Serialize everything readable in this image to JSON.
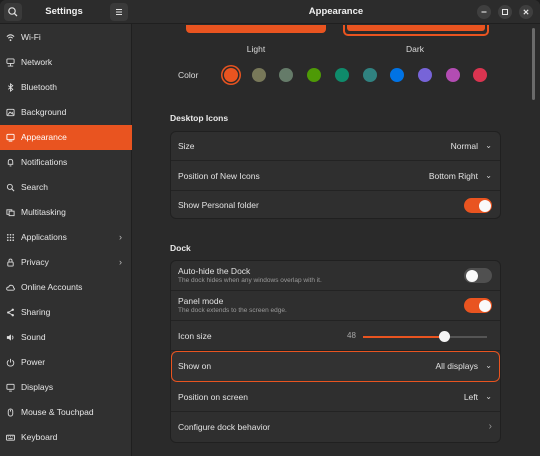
{
  "sidebar": {
    "title": "Settings",
    "items": [
      {
        "label": "Wi-Fi",
        "icon": "wifi-icon"
      },
      {
        "label": "Network",
        "icon": "network-icon"
      },
      {
        "label": "Bluetooth",
        "icon": "bluetooth-icon"
      },
      {
        "label": "Background",
        "icon": "background-icon"
      },
      {
        "label": "Appearance",
        "icon": "appearance-icon",
        "active": true
      },
      {
        "label": "Notifications",
        "icon": "bell-icon"
      },
      {
        "label": "Search",
        "icon": "search-icon"
      },
      {
        "label": "Multitasking",
        "icon": "multitasking-icon"
      },
      {
        "label": "Applications",
        "icon": "applications-icon",
        "chevron": true
      },
      {
        "label": "Privacy",
        "icon": "privacy-icon",
        "chevron": true
      },
      {
        "label": "Online Accounts",
        "icon": "online-accounts-icon"
      },
      {
        "label": "Sharing",
        "icon": "sharing-icon"
      },
      {
        "label": "Sound",
        "icon": "sound-icon"
      },
      {
        "label": "Power",
        "icon": "power-icon"
      },
      {
        "label": "Displays",
        "icon": "displays-icon"
      },
      {
        "label": "Mouse & Touchpad",
        "icon": "mouse-icon"
      },
      {
        "label": "Keyboard",
        "icon": "keyboard-icon"
      }
    ]
  },
  "header": {
    "title": "Appearance"
  },
  "style": {
    "light_label": "Light",
    "dark_label": "Dark",
    "color_label": "Color",
    "selected_color": "#e95420",
    "colors": [
      "#e95420",
      "#787859",
      "#657b69",
      "#4e9a06",
      "#0f8b6b",
      "#308280",
      "#0073e5",
      "#7764d8",
      "#b34cb3",
      "#da3450"
    ]
  },
  "desktop_icons": {
    "title": "Desktop Icons",
    "size_label": "Size",
    "size_value": "Normal",
    "position_label": "Position of New Icons",
    "position_value": "Bottom Right",
    "personal_folder_label": "Show Personal folder",
    "personal_folder_on": true
  },
  "dock": {
    "title": "Dock",
    "autohide_label": "Auto-hide the Dock",
    "autohide_sub": "The dock hides when any windows overlap with it.",
    "autohide_on": false,
    "panel_label": "Panel mode",
    "panel_sub": "The dock extends to the screen edge.",
    "panel_on": true,
    "icon_size_label": "Icon size",
    "icon_size_value": "48",
    "icon_size_fraction": 0.66,
    "show_on_label": "Show on",
    "show_on_value": "All displays",
    "position_label": "Position on screen",
    "position_value": "Left",
    "configure_label": "Configure dock behavior"
  }
}
